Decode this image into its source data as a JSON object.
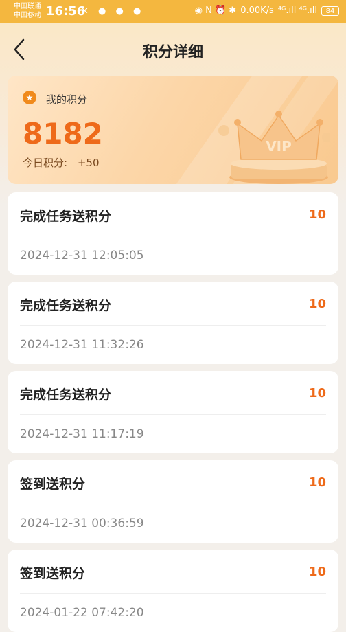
{
  "status_bar": {
    "carrier1": "中国联通",
    "carrier2": "中国移动",
    "time": "16:56",
    "left_icons": "✕ ● ● ●",
    "right_icons": "◉ N ⏰ ✱",
    "speed": "0.00K/s",
    "signal": "⁴ᴳ.ıll ⁴ᴳ.ıll",
    "battery": "84"
  },
  "nav": {
    "title": "积分详细"
  },
  "points_card": {
    "label": "我的积分",
    "value": "8182",
    "today_label": "今日积分:",
    "today_value": "+50",
    "vip_text": "VIP"
  },
  "records": [
    {
      "title": "完成任务送积分",
      "points": "10",
      "time": "2024-12-31 12:05:05"
    },
    {
      "title": "完成任务送积分",
      "points": "10",
      "time": "2024-12-31 11:32:26"
    },
    {
      "title": "完成任务送积分",
      "points": "10",
      "time": "2024-12-31 11:17:19"
    },
    {
      "title": "签到送积分",
      "points": "10",
      "time": "2024-12-31 00:36:59"
    },
    {
      "title": "签到送积分",
      "points": "10",
      "time": "2024-01-22 07:42:20"
    }
  ],
  "colors": {
    "accent": "#ee6a1a",
    "status_bar": "#f4b73f",
    "card_gold": "#fcd6a8"
  }
}
